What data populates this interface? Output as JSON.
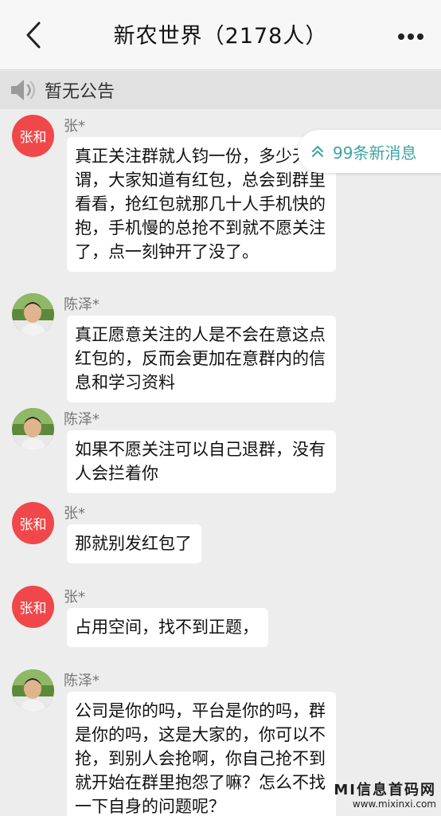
{
  "header": {
    "title": "新农世界（2178人）",
    "back_icon": "chevron-left-icon",
    "more_icon": "more-horizontal-icon"
  },
  "notice": {
    "icon": "speaker-icon",
    "text": "暂无公告"
  },
  "new_messages": {
    "icon": "double-chevron-up-icon",
    "text": "99条新消息"
  },
  "messages": [
    {
      "sender": "张*",
      "avatar_text": "张和",
      "avatar_type": "red",
      "text": "真正关注群就人钧一份，多少无所谓，大家知道有红包，总会到群里看看，抢红包就那几十人手机快的抱，手机慢的总抢不到就不愿关注了，点一刻钟开了没了。"
    },
    {
      "sender": "陈泽*",
      "avatar_text": "",
      "avatar_type": "photo",
      "text": "真正愿意关注的人是不会在意这点红包的，反而会更加在意群内的信息和学习资料"
    },
    {
      "sender": "陈泽*",
      "avatar_text": "",
      "avatar_type": "photo",
      "text": "如果不愿关注可以自己退群，没有人会拦着你"
    },
    {
      "sender": "张*",
      "avatar_text": "张和",
      "avatar_type": "red",
      "text": "那就别发红包了"
    },
    {
      "sender": "张*",
      "avatar_text": "张和",
      "avatar_type": "red",
      "text": "占用空间，找不到正题，"
    },
    {
      "sender": "陈泽*",
      "avatar_text": "",
      "avatar_type": "photo",
      "text": "公司是你的吗，平台是你的吗，群是你的吗，这是大家的，你可以不抢，到别人会抢啊，你自己抢不到就开始在群里抱怨了嘛？怎么不找一下自身的问题呢？"
    }
  ],
  "watermark": {
    "main": "MI信息首码网",
    "sub": "www.mixinxi.com"
  },
  "colors": {
    "avatar_red": "#f0484a",
    "accent_teal": "#3aa5a0",
    "background": "#ededed"
  }
}
